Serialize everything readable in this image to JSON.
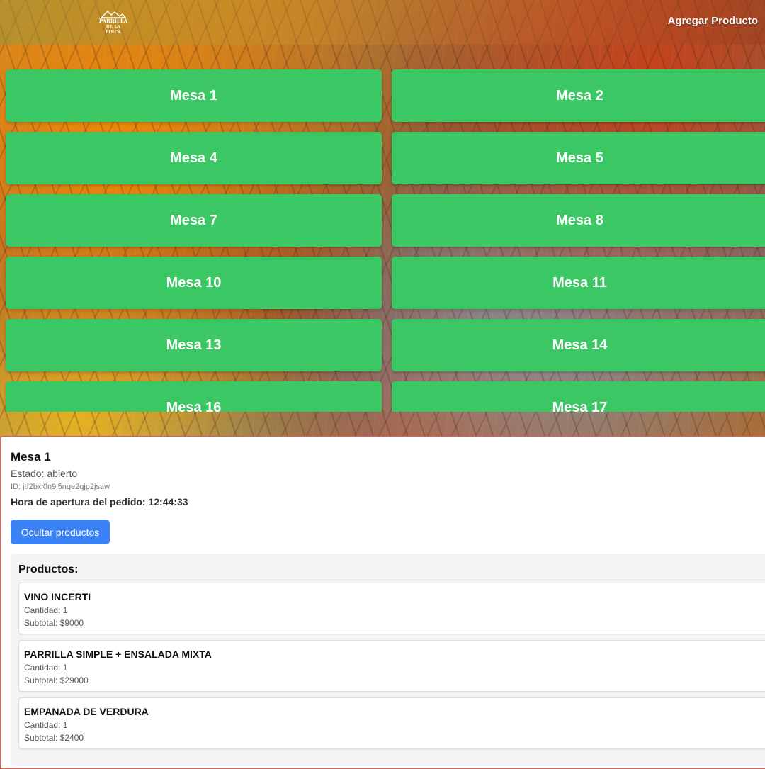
{
  "header": {
    "logo_text_line1": "PARRILLA",
    "logo_text_line2": "DE LA FINCA",
    "add_product_label": "Agregar Producto"
  },
  "tables": [
    "Mesa 1",
    "Mesa 2",
    "Mesa 4",
    "Mesa 5",
    "Mesa 7",
    "Mesa 8",
    "Mesa 10",
    "Mesa 11",
    "Mesa 13",
    "Mesa 14",
    "Mesa 16",
    "Mesa 17"
  ],
  "order": {
    "title": "Mesa 1",
    "status": "Estado: abierto",
    "id": "ID: jtf2bxi0n9l5nqe2qjp2jsaw",
    "open_time": "Hora de apertura del pedido: 12:44:33",
    "hide_button": "Ocultar productos",
    "products_title": "Productos:",
    "products": [
      {
        "name": "VINO INCERTI",
        "qty": "Cantidad: 1",
        "subtotal": "Subtotal: $9000"
      },
      {
        "name": "PARRILLA SIMPLE + ENSALADA MIXTA",
        "qty": "Cantidad: 1",
        "subtotal": "Subtotal: $29000"
      },
      {
        "name": "EMPANADA DE VERDURA",
        "qty": "Cantidad: 1",
        "subtotal": "Subtotal: $2400"
      }
    ]
  },
  "colors": {
    "table_button": "#3cc765",
    "primary_button": "#3b82f6",
    "panel_border": "#e25a5a",
    "products_bg": "#f3f4f6"
  }
}
